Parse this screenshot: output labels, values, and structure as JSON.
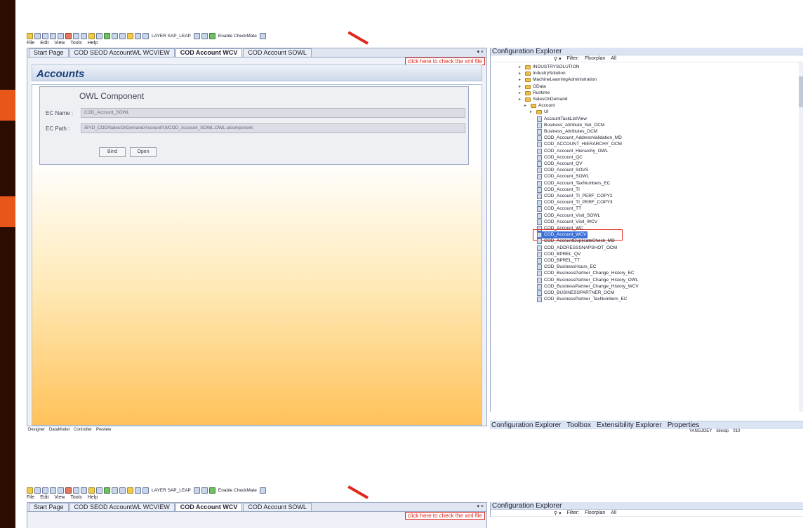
{
  "toolbar": {
    "layer_label": "LAYER SAP_LEAP",
    "checkmate_label": "Enable CheckMate"
  },
  "menu": [
    "File",
    "Edit",
    "View",
    "Tools",
    "Help"
  ],
  "tabs": [
    {
      "label": "Start Page",
      "active": false
    },
    {
      "label": "COD SEOD AccountWL WCVIEW",
      "active": false
    },
    {
      "label": "COD Account WCV",
      "active": true
    },
    {
      "label": "COD Account SOWL",
      "active": false
    }
  ],
  "tab_controls": "▾ ×",
  "xml_hint": "click here to check the xml file",
  "accounts_title": "Accounts",
  "owl": {
    "title": "OWL Component",
    "ec_name_label": "EC Name :",
    "ec_name_value": "COD_Account_SOWL",
    "ec_path_label": "EC Path :",
    "ec_path_value": "/BYD_COD/SalesOnDemand/Account/UI/COD_Account_SOWL.OWL.uicomponent",
    "bind_label": "Bind",
    "open_label": "Open"
  },
  "status_tabs": [
    "Designer",
    "DataModel",
    "Controller",
    "Preview"
  ],
  "explorer": {
    "title": "Configuration Explorer",
    "filter_label": "Filter:",
    "filter_value": "Floorplan",
    "filter_all": "All",
    "tree": [
      {
        "label": "INDUSTRYSOLUTION",
        "level": 0,
        "type": "folder"
      },
      {
        "label": "IndustrySolution",
        "level": 0,
        "type": "folder"
      },
      {
        "label": "MachineLearningAdministration",
        "level": 0,
        "type": "folder"
      },
      {
        "label": "OData",
        "level": 0,
        "type": "folder"
      },
      {
        "label": "Runtime",
        "level": 0,
        "type": "folder"
      },
      {
        "label": "SalesOnDemand",
        "level": 0,
        "type": "folder"
      },
      {
        "label": "Account",
        "level": 1,
        "type": "folder"
      },
      {
        "label": "UI",
        "level": 2,
        "type": "folder"
      },
      {
        "label": "AccountTaskListView",
        "level": 3,
        "type": "file"
      },
      {
        "label": "Business_Attribute_Set_OCM",
        "level": 3,
        "type": "file"
      },
      {
        "label": "Business_Attributes_OCM",
        "level": 3,
        "type": "file"
      },
      {
        "label": "COD_Account_AddressValidation_MD",
        "level": 3,
        "type": "file"
      },
      {
        "label": "COD_ACCOUNT_HIERARCHY_OCM",
        "level": 3,
        "type": "file"
      },
      {
        "label": "COD_Account_Hierarchy_OWL",
        "level": 3,
        "type": "file"
      },
      {
        "label": "COD_Account_QC",
        "level": 3,
        "type": "file"
      },
      {
        "label": "COD_Account_QV",
        "level": 3,
        "type": "file"
      },
      {
        "label": "COD_Account_SOVS",
        "level": 3,
        "type": "file"
      },
      {
        "label": "COD_Account_SOWL",
        "level": 3,
        "type": "file"
      },
      {
        "label": "COD_Account_TaxNumbers_EC",
        "level": 3,
        "type": "file"
      },
      {
        "label": "COD_Account_TI",
        "level": 3,
        "type": "file"
      },
      {
        "label": "COD_Account_TI_PERF_COPY2",
        "level": 3,
        "type": "file"
      },
      {
        "label": "COD_Account_TI_PERF_COPY3",
        "level": 3,
        "type": "file"
      },
      {
        "label": "COD_Account_TT",
        "level": 3,
        "type": "file"
      },
      {
        "label": "COD_Account_Visit_SOWL",
        "level": 3,
        "type": "file"
      },
      {
        "label": "COD_Account_Visit_WCV",
        "level": 3,
        "type": "file"
      },
      {
        "label": "COD_Account_WC",
        "level": 3,
        "type": "file"
      },
      {
        "label": "COD_Account_WCV",
        "level": 3,
        "type": "file",
        "selected": true
      },
      {
        "label": "COD_AccountDuplicateCheck_MD",
        "level": 3,
        "type": "file"
      },
      {
        "label": "COD_ADDRESSSNAPSHOT_OCM",
        "level": 3,
        "type": "file"
      },
      {
        "label": "COD_BPREL_QV",
        "level": 3,
        "type": "file"
      },
      {
        "label": "COD_BPREL_TT",
        "level": 3,
        "type": "file"
      },
      {
        "label": "COD_BusinessHours_EC",
        "level": 3,
        "type": "file"
      },
      {
        "label": "COD_BusinessPartner_Change_History_EC",
        "level": 3,
        "type": "file"
      },
      {
        "label": "COD_BusinessPartner_Change_History_OWL",
        "level": 3,
        "type": "file"
      },
      {
        "label": "COD_BusinessPartner_Change_History_WCV",
        "level": 3,
        "type": "file"
      },
      {
        "label": "COD_BUSINESSPARTNER_OCM",
        "level": 3,
        "type": "file"
      },
      {
        "label": "COD_BusinessPartner_TaxNumbers_EC",
        "level": 3,
        "type": "file"
      }
    ],
    "bottom_tabs": [
      "Configuration Explorer",
      "Toolbox",
      "Extensibility Explorer",
      "Properties"
    ]
  },
  "userbar": {
    "user": "YANGJOEY",
    "path": "/ide/ap",
    "client": "010"
  }
}
